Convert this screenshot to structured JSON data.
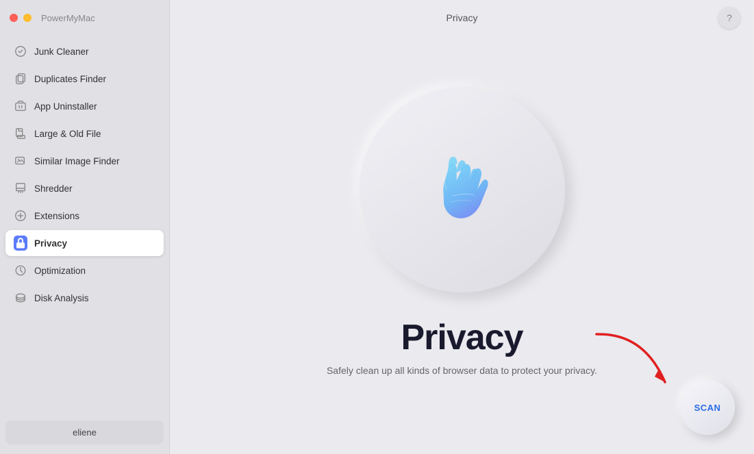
{
  "app": {
    "name": "PowerMyMac",
    "page_title": "Privacy"
  },
  "sidebar": {
    "items": [
      {
        "id": "junk-cleaner",
        "label": "Junk Cleaner",
        "icon": "junk"
      },
      {
        "id": "duplicates-finder",
        "label": "Duplicates Finder",
        "icon": "duplicates"
      },
      {
        "id": "app-uninstaller",
        "label": "App Uninstaller",
        "icon": "uninstaller"
      },
      {
        "id": "large-old-file",
        "label": "Large & Old File",
        "icon": "large-file"
      },
      {
        "id": "similar-image-finder",
        "label": "Similar Image Finder",
        "icon": "image"
      },
      {
        "id": "shredder",
        "label": "Shredder",
        "icon": "shredder"
      },
      {
        "id": "extensions",
        "label": "Extensions",
        "icon": "extensions"
      },
      {
        "id": "privacy",
        "label": "Privacy",
        "icon": "privacy",
        "active": true
      },
      {
        "id": "optimization",
        "label": "Optimization",
        "icon": "optimization"
      },
      {
        "id": "disk-analysis",
        "label": "Disk Analysis",
        "icon": "disk"
      }
    ],
    "user": {
      "label": "eliene"
    }
  },
  "main": {
    "title": "Privacy",
    "subtitle": "Safely clean up all kinds of browser data to protect your privacy.",
    "scan_label": "SCAN",
    "help_label": "?"
  }
}
